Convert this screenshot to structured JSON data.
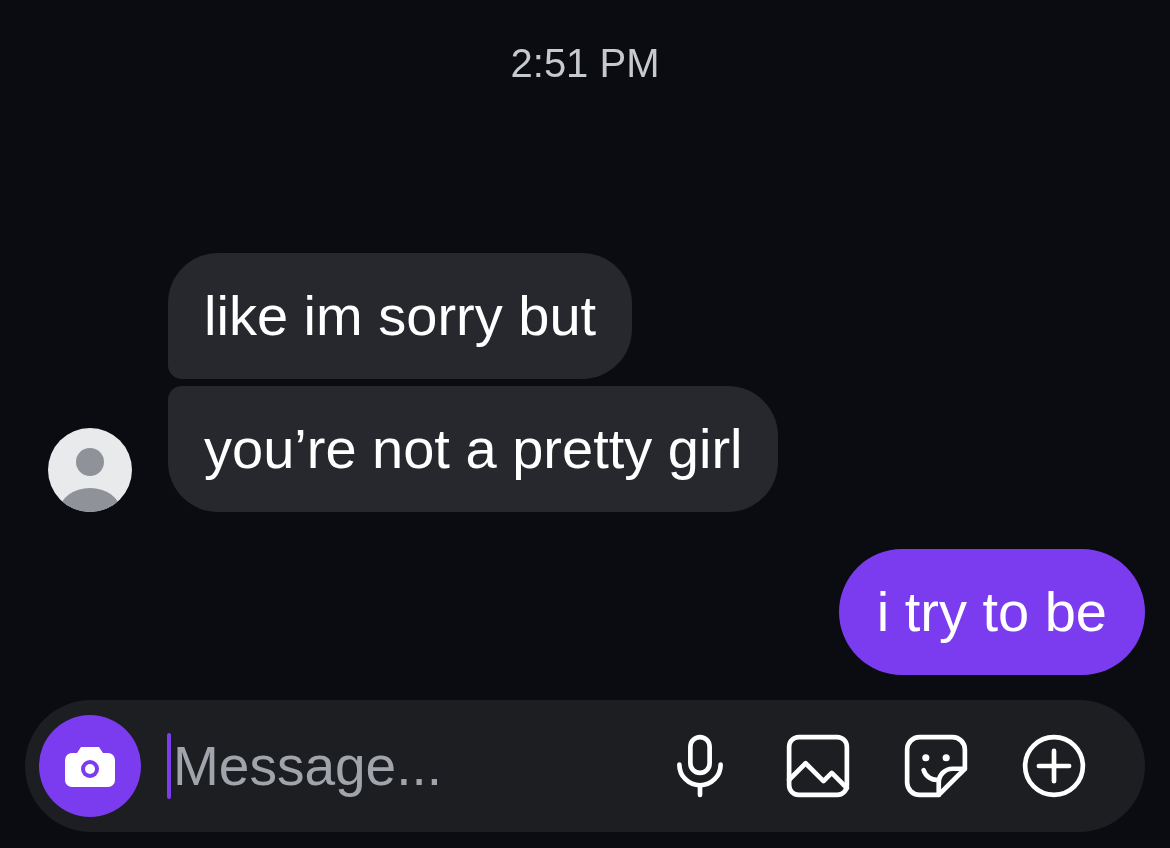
{
  "timestamp": "2:51 PM",
  "messages": [
    {
      "kind": "received",
      "text": "like im sorry but",
      "avatar": false
    },
    {
      "kind": "received",
      "text": "you’re not a pretty girl",
      "avatar": true
    },
    {
      "kind": "sent",
      "text": "i try to be"
    }
  ],
  "composer": {
    "placeholder": "Message...",
    "focused": true
  }
}
